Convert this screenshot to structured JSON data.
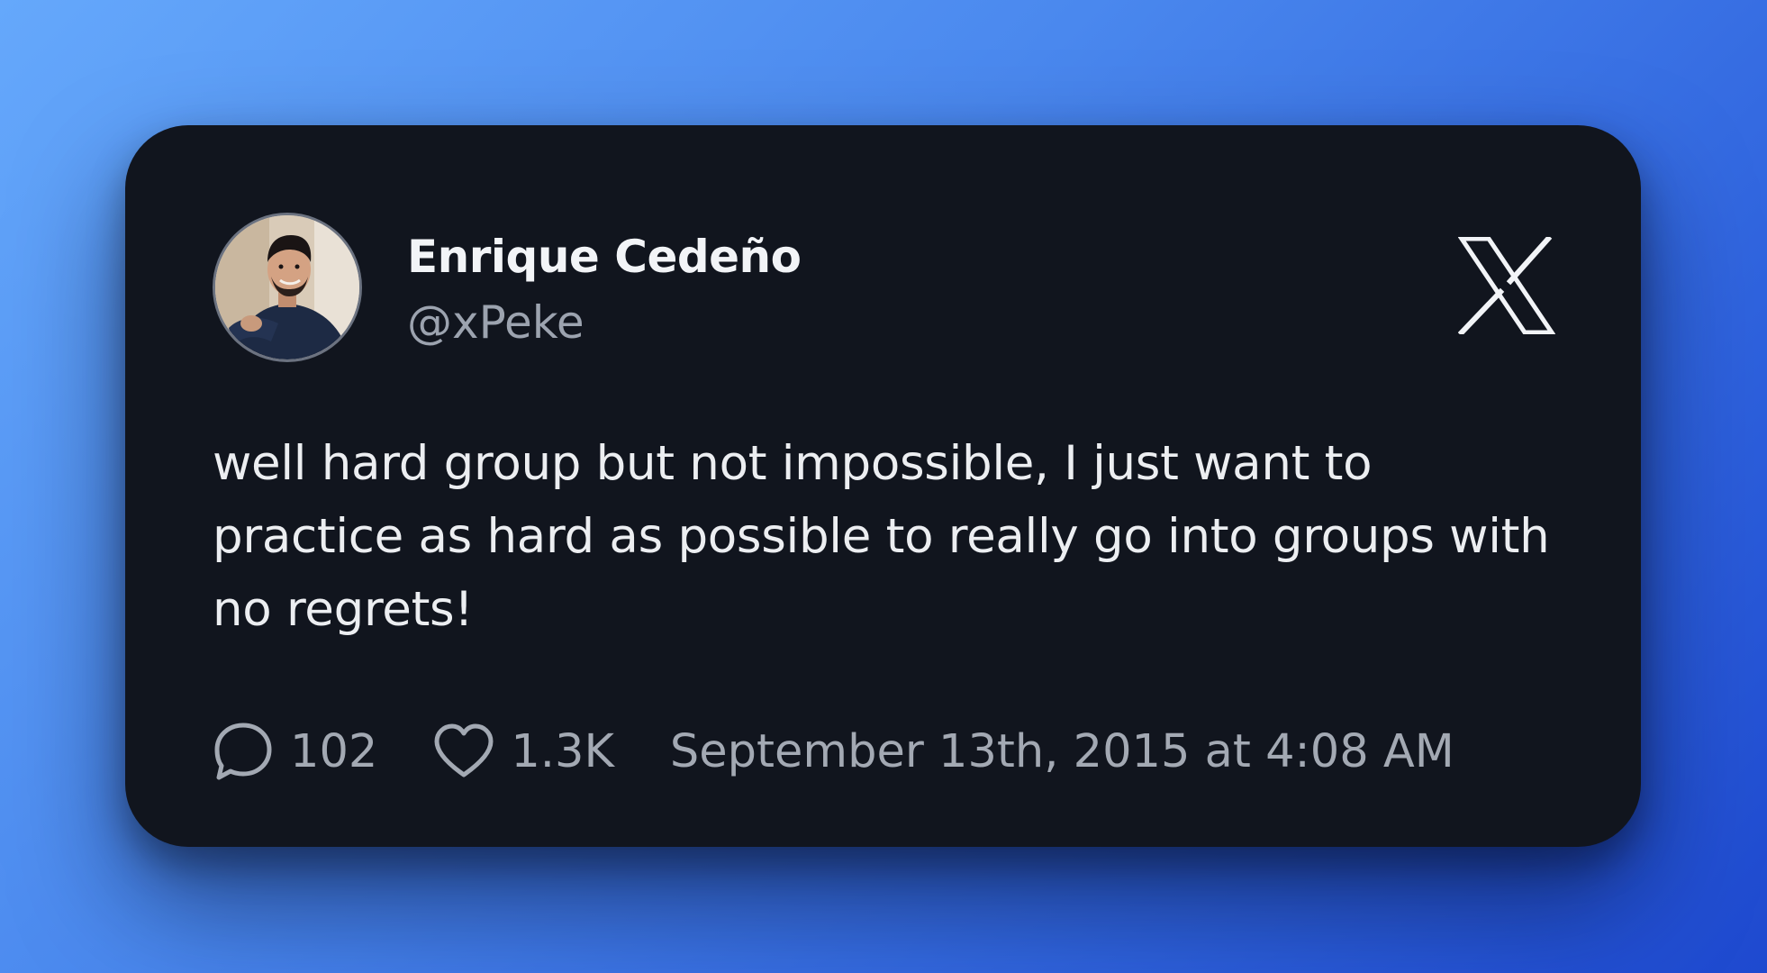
{
  "tweet": {
    "author_name": "Enrique Cedeño",
    "author_handle": "@xPeke",
    "text": "well hard group but not impossible, I just want to practice as hard as possible to really go into groups with no regrets!",
    "replies": "102",
    "likes": "1.3K",
    "timestamp": "September 13th, 2015 at 4:08 AM"
  },
  "icons": {
    "platform_logo": "x-logo-icon",
    "replies": "speech-bubble-icon",
    "likes": "heart-icon"
  },
  "colors": {
    "background_gradient_start": "#65a8fb",
    "background_gradient_end": "#1e49cf",
    "card_background": "#11151e",
    "primary_text": "#eceef1",
    "secondary_text": "#9ca3af"
  }
}
